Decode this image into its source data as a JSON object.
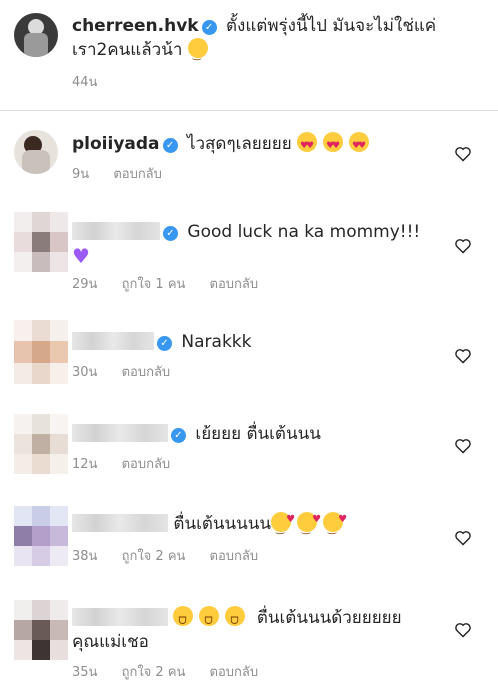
{
  "post": {
    "username": "cherreen.hvk",
    "caption_line1": "ตั้งแต่พรุ่งนี้ไป มันจะไม่ใช่แค่",
    "caption_line2": "เรา2คนแล้วน้า",
    "time": "44น"
  },
  "comments": [
    {
      "username": "ploiiyada",
      "text": "ไวสุดๆเลยยยย",
      "time": "9น",
      "likes": "",
      "reply": "ตอบกลับ",
      "emoji": "heart-eyes x3"
    },
    {
      "username": "",
      "text": "Good luck na ka mommy!!!",
      "time": "29น",
      "likes": "ถูกใจ 1 คน",
      "reply": "ตอบกลับ",
      "emoji": "purple-heart"
    },
    {
      "username": "",
      "text": "Narakkk",
      "time": "30น",
      "likes": "",
      "reply": "ตอบกลับ"
    },
    {
      "username": "",
      "text": "เย้ยยย ตื่นเต้นนน",
      "time": "12น",
      "likes": "",
      "reply": "ตอบกลับ"
    },
    {
      "username": "",
      "text": "ตื่นเต้นนนนน",
      "time": "38น",
      "likes": "ถูกใจ 2 คน",
      "reply": "ตอบกลับ",
      "emoji": "smiling-face-with-hearts x3"
    },
    {
      "username": "",
      "text": "ตื่นเต้นนนด้วยยยยย",
      "text_line2": "คุณแม่เชอ",
      "time": "35น",
      "likes": "ถูกใจ 2 คน",
      "reply": "ตอบกลับ",
      "emoji": "laughing x3"
    }
  ],
  "colors": {
    "verified": "#3897f0",
    "muted": "#8e8e8e",
    "text": "#262626"
  },
  "icons": [
    "verified-badge-icon",
    "heart-outline-icon",
    "heart-eyes-emoji",
    "purple-heart-emoji",
    "smiling-face-with-hearts-emoji",
    "laughing-emoji"
  ]
}
